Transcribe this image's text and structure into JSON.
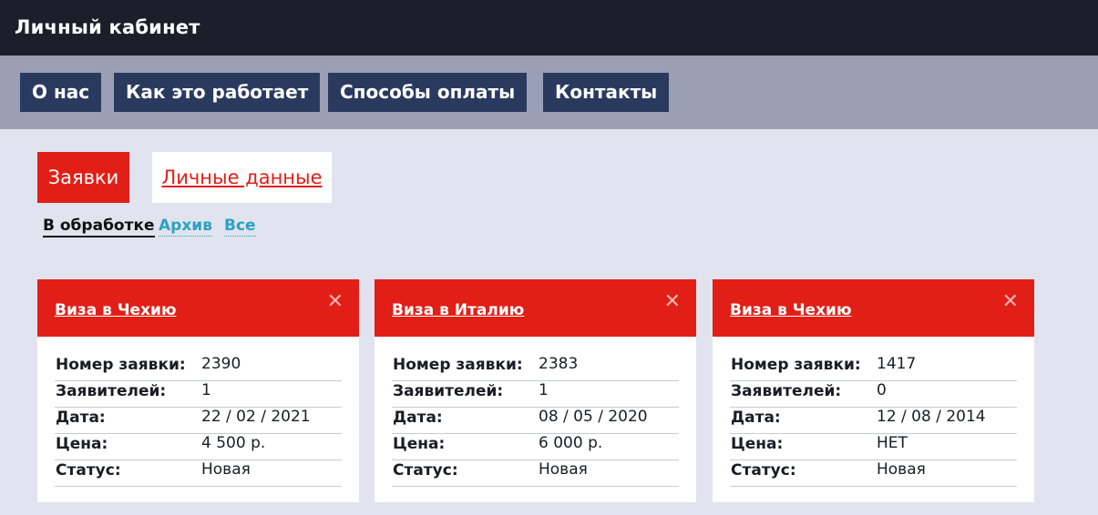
{
  "header": {
    "title": "Личный кабинет"
  },
  "nav": {
    "items": [
      {
        "label": "О нас"
      },
      {
        "label": "Как это работает"
      },
      {
        "label": "Способы оплаты"
      },
      {
        "label": "Контакты"
      }
    ]
  },
  "tabs": {
    "active": "Заявки",
    "inactive": "Личные данные"
  },
  "filters": [
    {
      "label": "В обработке",
      "active": true
    },
    {
      "label": "Архив",
      "active": false
    },
    {
      "label": "Все",
      "active": false
    }
  ],
  "cards": [
    {
      "title": "Виза в Чехию",
      "close": "✕",
      "rows": [
        {
          "key": "Номер заявки:",
          "value": "2390"
        },
        {
          "key": "Заявителей:",
          "value": "1"
        },
        {
          "key": "Дата:",
          "value": "22 / 02 / 2021"
        },
        {
          "key": "Цена:",
          "value": "4 500 р."
        },
        {
          "key": "Статус:",
          "value": "Новая"
        }
      ]
    },
    {
      "title": "Виза в Италию",
      "close": "✕",
      "rows": [
        {
          "key": "Номер заявки:",
          "value": "2383"
        },
        {
          "key": "Заявителей:",
          "value": "1"
        },
        {
          "key": "Дата:",
          "value": "08 / 05 / 2020"
        },
        {
          "key": "Цена:",
          "value": "6 000 р."
        },
        {
          "key": "Статус:",
          "value": "Новая"
        }
      ]
    },
    {
      "title": "Виза в Чехию",
      "close": "✕",
      "rows": [
        {
          "key": "Номер заявки:",
          "value": "1417"
        },
        {
          "key": "Заявителей:",
          "value": "0"
        },
        {
          "key": "Дата:",
          "value": "12 / 08 / 2014"
        },
        {
          "key": "Цена:",
          "value": "НЕТ"
        },
        {
          "key": "Статус:",
          "value": "Новая"
        }
      ]
    }
  ],
  "colors": {
    "topbar": "#1c1f29",
    "navbar": "#9a9fb6",
    "nav_button": "#2a3a5f",
    "accent_red": "#e11f16",
    "link_blue": "#2ba2c3",
    "page_bg": "#e1e4ee"
  }
}
